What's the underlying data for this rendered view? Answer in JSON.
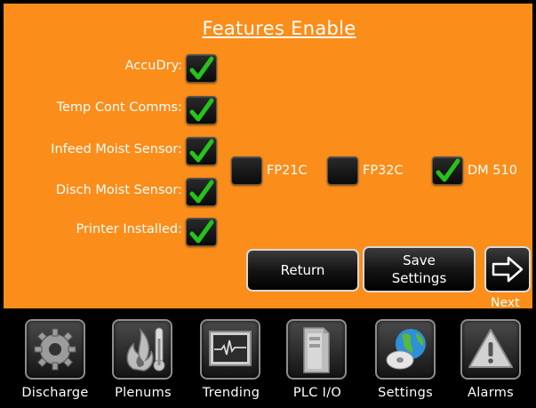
{
  "screen": {
    "title": "Features Enable"
  },
  "features": [
    {
      "label": "AccuDry:",
      "checked": true
    },
    {
      "label": "Temp Cont Comms:",
      "checked": true
    },
    {
      "label": "Infeed Moist Sensor:",
      "checked": true
    },
    {
      "label": "Disch Moist Sensor:",
      "checked": true
    },
    {
      "label": "Printer Installed:",
      "checked": true
    }
  ],
  "sensor_options": [
    {
      "label": "FP21C",
      "checked": false
    },
    {
      "label": "FP32C",
      "checked": false
    },
    {
      "label": "DM 510",
      "checked": true
    }
  ],
  "buttons": {
    "return_label": "Return",
    "save_label_line1": "Save",
    "save_label_line2": "Settings",
    "next_label": "Next"
  },
  "nav": [
    {
      "label": "Discharge",
      "icon": "gear-icon"
    },
    {
      "label": "Plenums",
      "icon": "flame-thermometer-icon"
    },
    {
      "label": "Trending",
      "icon": "trend-monitor-icon"
    },
    {
      "label": "PLC I/O",
      "icon": "plc-module-icon"
    },
    {
      "label": "Settings",
      "icon": "globe-disc-icon"
    },
    {
      "label": "Alarms",
      "icon": "warning-icon"
    }
  ],
  "colors": {
    "panel_background": "#fb8d1a",
    "checkmark": "#27c21c",
    "nav_background": "#000000"
  }
}
